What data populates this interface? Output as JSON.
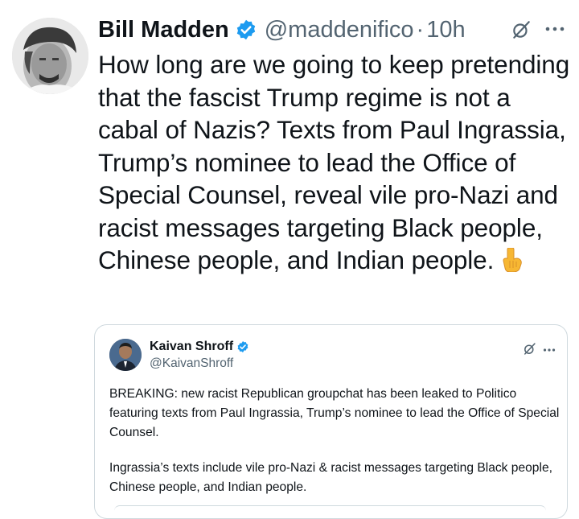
{
  "tweet": {
    "author_name": "Bill Madden",
    "handle": "@maddenifico",
    "separator": "·",
    "time": "10h",
    "text": "How long are we going to keep pretending that the fascist Trump regime is not a cabal of Nazis? Texts from Paul Ingrassia, Trump’s nominee to lead the Office of Special Counsel, reveal vile pro-Nazi and racist messages targeting Black people, Chinese people, and Indian people.",
    "emoji_icon": "backhand-index-pointing-down"
  },
  "quoted_tweet": {
    "author_name": "Kaivan Shroff",
    "handle": "@KaivanShroff",
    "paragraph_1": "BREAKING: new racist Republican groupchat has been leaked to Politico featuring texts from Paul Ingrassia, Trump’s nominee to lead the Office of Special Counsel.",
    "paragraph_2": "Ingrassia’s texts include vile pro-Nazi & racist messages targeting Black people, Chinese people, and Indian people."
  },
  "colors": {
    "verified_badge": "#1d9bf0",
    "secondary_text": "#536471",
    "primary_text": "#0f1419",
    "border": "#cfd9de"
  }
}
